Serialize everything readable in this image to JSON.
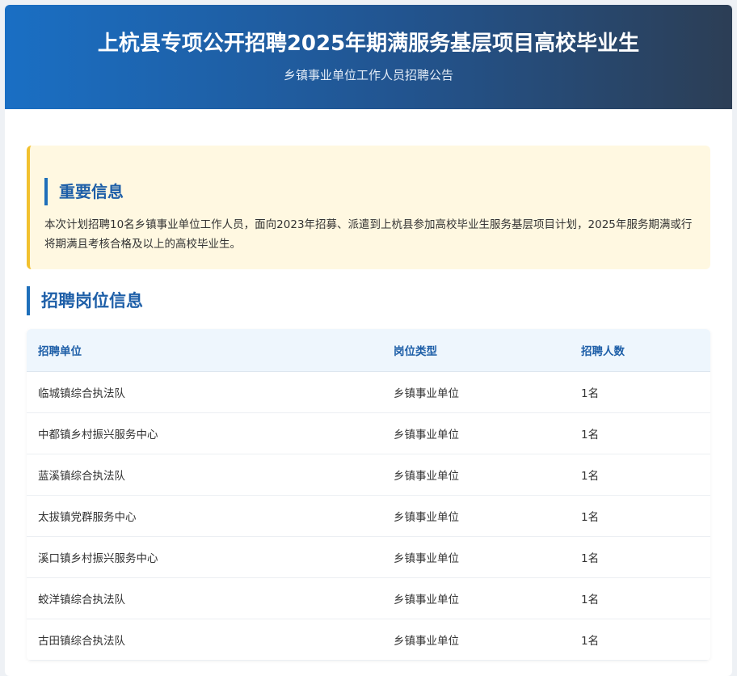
{
  "header": {
    "title": "上杭县专项公开招聘2025年期满服务基层项目高校毕业生",
    "subtitle": "乡镇事业单位工作人员招聘公告"
  },
  "notice": {
    "title": "重要信息",
    "text": "本次计划招聘10名乡镇事业单位工作人员，面向2023年招募、派遣到上杭县参加高校毕业生服务基层项目计划，2025年服务期满或行将期满且考核合格及以上的高校毕业生。"
  },
  "section": {
    "title": "招聘岗位信息"
  },
  "table": {
    "headers": [
      "招聘单位",
      "岗位类型",
      "招聘人数"
    ],
    "rows": [
      [
        "临城镇综合执法队",
        "乡镇事业单位",
        "1名"
      ],
      [
        "中都镇乡村振兴服务中心",
        "乡镇事业单位",
        "1名"
      ],
      [
        "蓝溪镇综合执法队",
        "乡镇事业单位",
        "1名"
      ],
      [
        "太拔镇党群服务中心",
        "乡镇事业单位",
        "1名"
      ],
      [
        "溪口镇乡村振兴服务中心",
        "乡镇事业单位",
        "1名"
      ],
      [
        "蛟洋镇综合执法队",
        "乡镇事业单位",
        "1名"
      ],
      [
        "古田镇综合执法队",
        "乡镇事业单位",
        "1名"
      ]
    ]
  },
  "colors": {
    "header_start": "#1a6fc4",
    "header_end": "#2c3e55",
    "accent_blue": "#1e5fa8",
    "notice_bg": "#fff8e1",
    "notice_border": "#f2c12e"
  }
}
